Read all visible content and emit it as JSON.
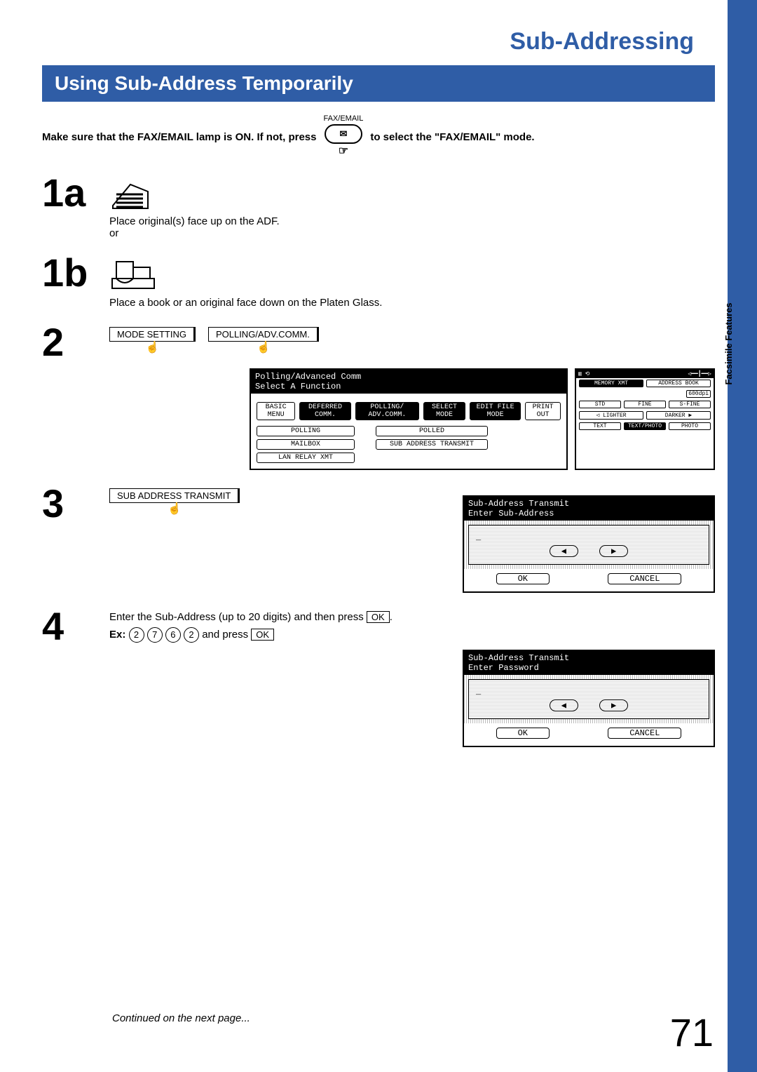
{
  "page_title": "Sub-Addressing",
  "section_title": "Using Sub-Address Temporarily",
  "intro_part1": "Make sure that the FAX/EMAIL lamp is ON.  If not, press",
  "intro_button_label": "FAX/EMAIL",
  "intro_button_glyph": "✉",
  "intro_part2": "to select the \"FAX/EMAIL\" mode.",
  "side_tab": "Facsimile Features",
  "steps": {
    "s1a": {
      "num": "1a",
      "text": "Place original(s) face up on the ADF.",
      "or": "or"
    },
    "s1b": {
      "num": "1b",
      "text": "Place a book or an original face down on the Platen Glass."
    },
    "s2": {
      "num": "2",
      "btn1": "MODE SETTING",
      "btn2": "POLLING/ADV.COMM."
    },
    "s3": {
      "num": "3",
      "btn": "SUB ADDRESS TRANSMIT"
    },
    "s4": {
      "num": "4",
      "line1a": "Enter the Sub-Address (up to 20 digits) and then press ",
      "ok": "OK",
      "period": ".",
      "ex_label": "Ex:",
      "keys": [
        "2",
        "7",
        "6",
        "2"
      ],
      "and_press": " and press "
    }
  },
  "lcd1": {
    "header": "Polling/Advanced Comm\nSelect A Function",
    "top_tabs": [
      "BASIC MENU",
      "DEFERRED COMM.",
      "POLLING/ ADV.COMM.",
      "SELECT MODE",
      "EDIT FILE MODE",
      "PRINT OUT"
    ],
    "left_buttons": [
      "POLLING",
      "MAILBOX",
      "LAN RELAY XMT"
    ],
    "right_buttons": [
      "POLLED",
      "SUB ADDRESS TRANSMIT"
    ]
  },
  "side_panel": {
    "top": [
      "MEMORY XMT",
      "ADDRESS BOOK"
    ],
    "dpi": "600dpi",
    "res": [
      "STD",
      "FINE",
      "S-FINE"
    ],
    "contrast": [
      "LIGHTER",
      "DARKER"
    ],
    "orig": [
      "TEXT",
      "TEXT/PHOTO",
      "PHOTO"
    ]
  },
  "lcd2": {
    "header": "Sub-Address Transmit\nEnter Sub-Address",
    "value": "_",
    "ok": "OK",
    "cancel": "CANCEL"
  },
  "lcd3": {
    "header": "Sub-Address Transmit\nEnter Password",
    "value": "_",
    "ok": "OK",
    "cancel": "CANCEL"
  },
  "continued": "Continued on the next page...",
  "pagenum": "71"
}
